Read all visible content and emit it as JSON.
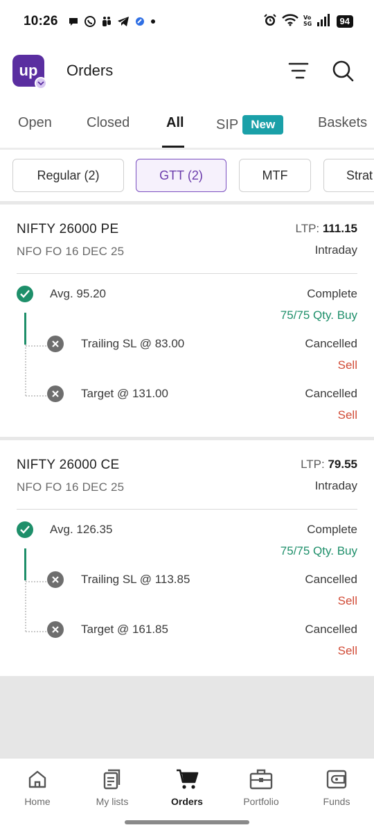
{
  "status_bar": {
    "time": "10:26",
    "battery": "94",
    "notification_icons": [
      "chat-bubble-icon",
      "whatsapp-icon",
      "teams-icon",
      "telegram-icon",
      "app-icon",
      "dot-icon"
    ],
    "system_icons": [
      "alarm-icon",
      "wifi-icon",
      "volte-icon",
      "signal-icon"
    ]
  },
  "header": {
    "logo_text": "up",
    "title": "Orders",
    "actions": [
      "filter-sort-icon",
      "search-icon"
    ]
  },
  "tabs": [
    {
      "label": "Open",
      "active": false
    },
    {
      "label": "Closed",
      "active": false
    },
    {
      "label": "All",
      "active": true
    },
    {
      "label": "SIP",
      "badge": "New",
      "active": false
    },
    {
      "label": "Baskets",
      "active": false
    }
  ],
  "filters": [
    {
      "label": "Regular (2)",
      "selected": false
    },
    {
      "label": "GTT (2)",
      "selected": true
    },
    {
      "label": "MTF",
      "selected": false
    },
    {
      "label": "Strat",
      "selected": false
    }
  ],
  "orders": [
    {
      "instrument": "NIFTY 26000 PE",
      "exchange_info": "NFO FO 16 DEC 25",
      "ltp_label": "LTP: ",
      "ltp_value": "111.15",
      "product": "Intraday",
      "main_leg": {
        "text": "Avg. 95.20",
        "status": "Complete",
        "detail": "75/75 Qty. Buy"
      },
      "sub_legs": [
        {
          "text": "Trailing SL @ 83.00",
          "status": "Cancelled",
          "side": "Sell"
        },
        {
          "text": "Target @ 131.00",
          "status": "Cancelled",
          "side": "Sell"
        }
      ]
    },
    {
      "instrument": "NIFTY 26000 CE",
      "exchange_info": "NFO FO 16 DEC 25",
      "ltp_label": "LTP: ",
      "ltp_value": "79.55",
      "product": "Intraday",
      "main_leg": {
        "text": "Avg. 126.35",
        "status": "Complete",
        "detail": "75/75 Qty. Buy"
      },
      "sub_legs": [
        {
          "text": "Trailing SL @ 113.85",
          "status": "Cancelled",
          "side": "Sell"
        },
        {
          "text": "Target @ 161.85",
          "status": "Cancelled",
          "side": "Sell"
        }
      ]
    }
  ],
  "bottom_nav": [
    {
      "label": "Home",
      "icon": "home-icon",
      "active": false
    },
    {
      "label": "My lists",
      "icon": "list-icon",
      "active": false
    },
    {
      "label": "Orders",
      "icon": "cart-icon",
      "active": true
    },
    {
      "label": "Portfolio",
      "icon": "briefcase-icon",
      "active": false
    },
    {
      "label": "Funds",
      "icon": "wallet-icon",
      "active": false
    }
  ],
  "colors": {
    "brand": "#5a2ea0",
    "positive": "#1e8f6a",
    "negative": "#d14a35",
    "badge": "#1aa0a8",
    "selected_chip": "#7a4ec0"
  }
}
